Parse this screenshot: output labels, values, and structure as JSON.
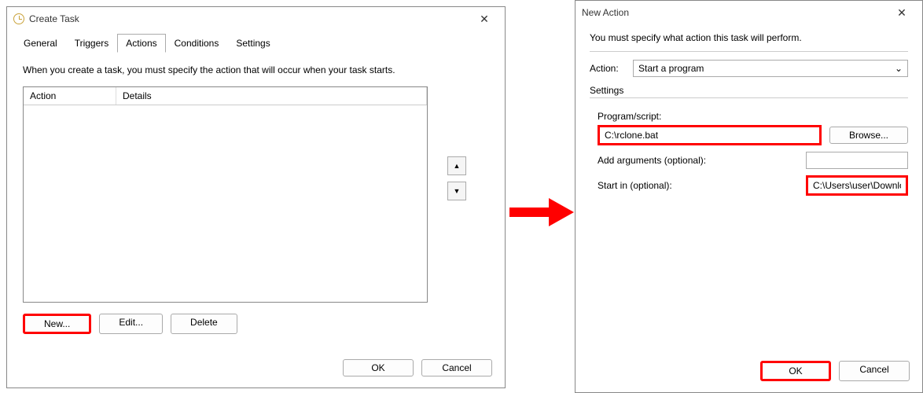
{
  "left": {
    "title": "Create Task",
    "tabs": {
      "general": "General",
      "triggers": "Triggers",
      "actions": "Actions",
      "conditions": "Conditions",
      "settings": "Settings"
    },
    "instruction": "When you create a task, you must specify the action that will occur when your task starts.",
    "columns": {
      "action": "Action",
      "details": "Details"
    },
    "updown": {
      "up": "▲",
      "down": "▼"
    },
    "buttons": {
      "new": "New...",
      "edit": "Edit...",
      "delete": "Delete"
    },
    "footer": {
      "ok": "OK",
      "cancel": "Cancel"
    }
  },
  "right": {
    "title": "New Action",
    "instruction": "You must specify what action this task will perform.",
    "action_label": "Action:",
    "action_value": "Start a program",
    "settings_label": "Settings",
    "program_label": "Program/script:",
    "program_value": "C:\\rclone.bat",
    "browse": "Browse...",
    "args_label": "Add arguments (optional):",
    "args_value": "",
    "startin_label": "Start in (optional):",
    "startin_value": "C:\\Users\\user\\Downloads",
    "footer": {
      "ok": "OK",
      "cancel": "Cancel"
    }
  }
}
